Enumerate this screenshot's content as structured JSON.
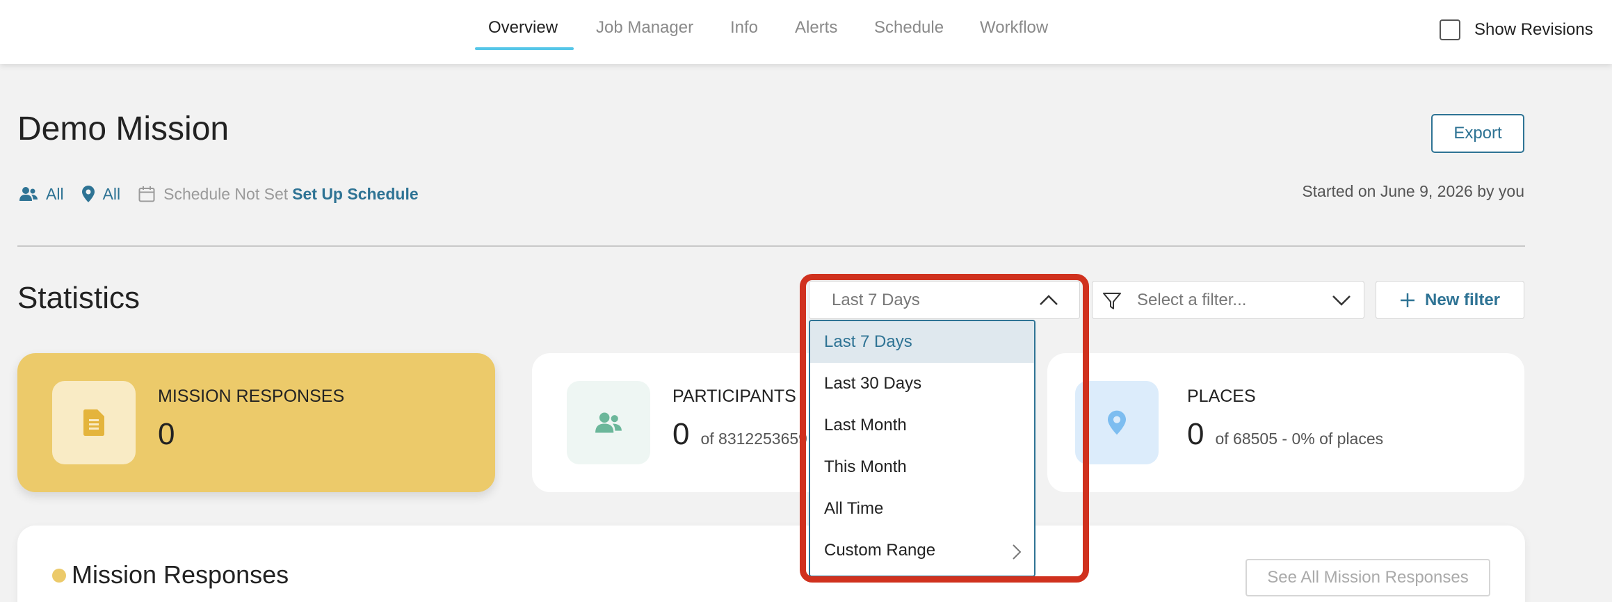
{
  "nav": {
    "tabs": [
      {
        "label": "Overview"
      },
      {
        "label": "Job Manager"
      },
      {
        "label": "Info"
      },
      {
        "label": "Alerts"
      },
      {
        "label": "Schedule"
      },
      {
        "label": "Workflow"
      }
    ],
    "active_tab": "Overview",
    "show_revisions_label": "Show Revisions",
    "show_revisions_checked": false
  },
  "mission": {
    "title": "Demo Mission",
    "export_label": "Export",
    "participants_filter": "All",
    "places_filter": "All",
    "schedule_status": "Schedule Not Set",
    "setup_schedule_link": "Set Up Schedule",
    "started_text": "Started on June 9, 2026 by you"
  },
  "statistics": {
    "title": "Statistics",
    "date_range": {
      "selected": "Last 7 Days",
      "options": [
        "Last 7 Days",
        "Last 30 Days",
        "Last Month",
        "This Month",
        "All Time",
        "Custom Range"
      ]
    },
    "filter_placeholder": "Select a filter...",
    "new_filter_label": "New filter"
  },
  "cards": [
    {
      "label": "MISSION RESPONSES",
      "value": "0",
      "sub": ""
    },
    {
      "label": "PARTICIPANTS",
      "value": "0",
      "sub": "of 8312253659"
    },
    {
      "label": "PLACES",
      "value": "0",
      "sub": "of 68505 - 0% of places"
    }
  ],
  "responses_section": {
    "title": "Mission Responses",
    "see_all_label": "See All Mission Responses"
  },
  "colors": {
    "accent": "#2e7394",
    "tab_underline": "#55c6e8",
    "highlight": "#d0311e",
    "card_yellow": "#ecca6a",
    "participants_icon_bg": "#eef6f3",
    "places_icon_bg": "#dcecfb"
  },
  "icons": {
    "participants": "users-icon",
    "places": "map-pin-icon",
    "schedule": "calendar-icon",
    "responses": "document-icon",
    "filter": "funnel-icon",
    "new_filter": "plus-icon"
  }
}
